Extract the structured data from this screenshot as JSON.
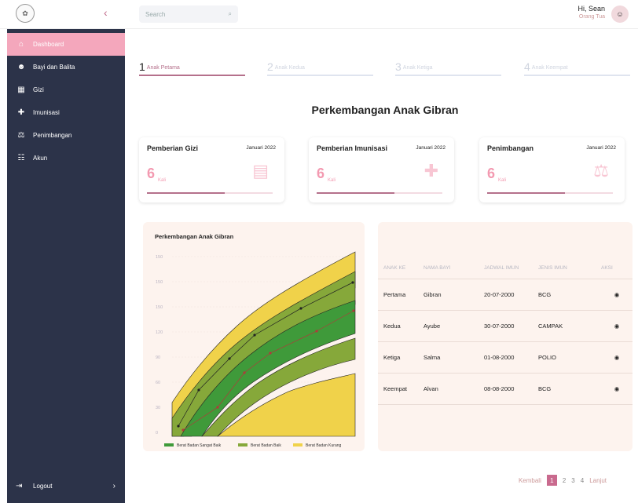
{
  "header": {
    "search_placeholder": "Search",
    "greeting": "Hi, Sean",
    "role": "Orang Tua"
  },
  "sidebar": {
    "items": [
      {
        "label": "Dashboard",
        "icon": "home-icon"
      },
      {
        "label": "Bayi dan Balita",
        "icon": "baby-icon"
      },
      {
        "label": "Gizi",
        "icon": "food-icon"
      },
      {
        "label": "Imunisasi",
        "icon": "vaccine-icon"
      },
      {
        "label": "Penimbangan",
        "icon": "scale-icon"
      },
      {
        "label": "Akun",
        "icon": "users-icon"
      }
    ],
    "logout": "Logout"
  },
  "steps": [
    {
      "num": "1",
      "label": "Anak Petama"
    },
    {
      "num": "2",
      "label": "Anak Kedua"
    },
    {
      "num": "3",
      "label": "Anak Ketiga"
    },
    {
      "num": "4",
      "label": "Anak Keempat"
    }
  ],
  "page_title": "Perkembangan Anak Gibran",
  "cards": [
    {
      "title": "Pemberian Gizi",
      "date": "Januari 2022",
      "count": "6",
      "unit": "Kali",
      "icon": "food-icon",
      "progress": 0.62
    },
    {
      "title": "Pemberian Imunisasi",
      "date": "Januari 2022",
      "count": "6",
      "unit": "Kali",
      "icon": "vaccine-icon",
      "progress": 0.62
    },
    {
      "title": "Penimbangan",
      "date": "Januari 2022",
      "count": "6",
      "unit": "Kali",
      "icon": "scale-icon",
      "progress": 0.62
    }
  ],
  "chart_data": {
    "type": "area",
    "title": "Perkembangan Anak Gibran",
    "y_ticks": [
      "0",
      "30",
      "60",
      "90",
      "120",
      "150",
      "150",
      "150"
    ],
    "legend": [
      "Berat Badan Sangat Baik",
      "Berat Badan Baik",
      "Berat Badan Kurang"
    ],
    "colors": {
      "sangat_baik": "#3f9a3a",
      "baik": "#86a83a",
      "kurang": "#f0d24a"
    }
  },
  "table": {
    "headers": [
      "ANAK KE",
      "NAMA BAYI",
      "JADWAL IMUN",
      "JENIS IMUN",
      "AKSI"
    ],
    "rows": [
      [
        "Pertama",
        "Gibran",
        "20-07-2000",
        "BCG"
      ],
      [
        "Kedua",
        "Ayube",
        "30-07-2000",
        "CAMPAK"
      ],
      [
        "Ketiga",
        "Salma",
        "01-08-2000",
        "POLIO"
      ],
      [
        "Keempat",
        "Alvan",
        "08-08-2000",
        "BCG"
      ]
    ]
  },
  "pager": {
    "prev": "Kembali",
    "pages": [
      "1",
      "2",
      "3",
      "4"
    ],
    "next": "Lanjut"
  }
}
